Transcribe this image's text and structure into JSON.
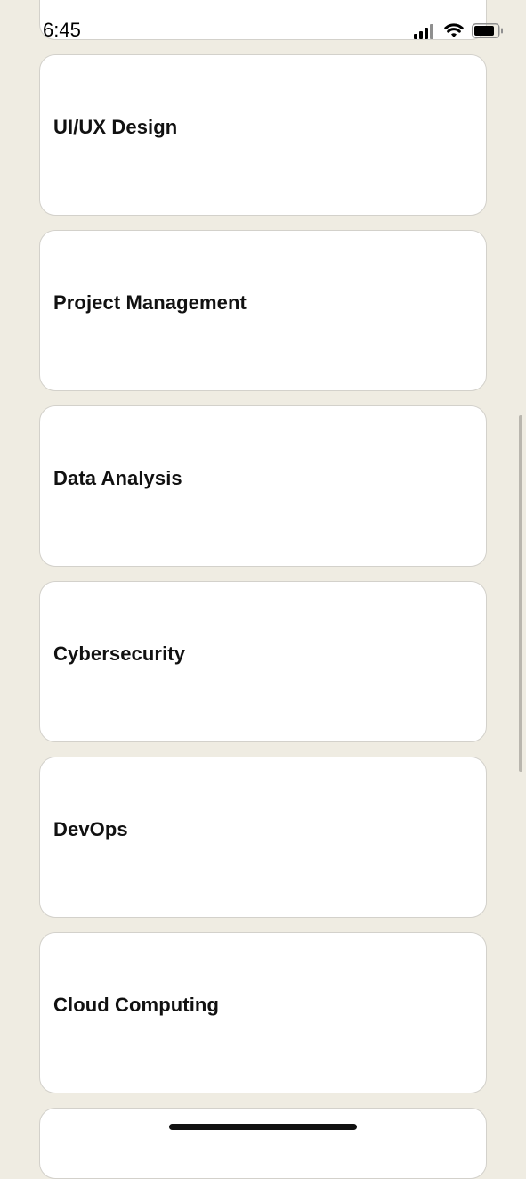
{
  "status_bar": {
    "time": "6:45"
  },
  "courses": [
    {
      "label": "UI/UX Design"
    },
    {
      "label": "Project Management"
    },
    {
      "label": "Data Analysis"
    },
    {
      "label": "Cybersecurity"
    },
    {
      "label": "DevOps"
    },
    {
      "label": "Cloud Computing"
    }
  ],
  "icons": [
    "signal-icon",
    "wifi-icon",
    "battery-icon"
  ],
  "colors": {
    "background": "#efece2",
    "card": "#ffffff",
    "card_border": "#d3d1cb",
    "text": "#111111"
  }
}
